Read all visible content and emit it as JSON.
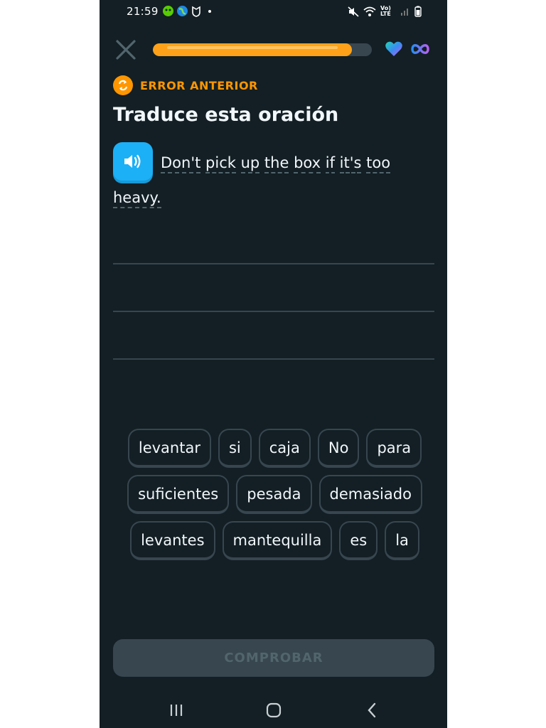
{
  "status_bar": {
    "time": "21:59",
    "network_label": "Vo) LTE"
  },
  "header": {
    "progress": 0.91,
    "accent_color": "#ffa21a",
    "hearts_icon": "heart-icon",
    "lives_icon": "infinity-icon"
  },
  "previous_error_label": "ERROR ANTERIOR",
  "title": "Traduce esta oración",
  "sentence_words": [
    "Don't",
    "pick",
    "up",
    "the",
    "box",
    "if",
    "it's",
    "too",
    "heavy."
  ],
  "word_bank": [
    [
      "levantar",
      "si",
      "caja",
      "No",
      "para"
    ],
    [
      "suficientes",
      "pesada",
      "demasiado"
    ],
    [
      "levantes",
      "mantequilla",
      "es",
      "la"
    ]
  ],
  "check_button_label": "COMPROBAR"
}
